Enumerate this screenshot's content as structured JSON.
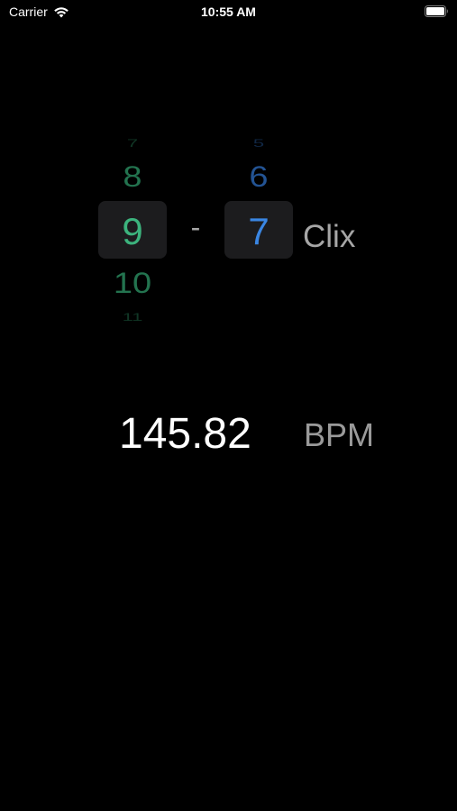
{
  "status_bar": {
    "carrier": "Carrier",
    "time": "10:55 AM",
    "wifi_icon": "wifi-icon",
    "battery_icon": "battery-icon"
  },
  "picker_left": {
    "items": [
      "7",
      "8",
      "9",
      "10",
      "11"
    ],
    "selected": "9",
    "color": "#3cb37d"
  },
  "picker_right": {
    "items": [
      "5",
      "6",
      "7"
    ],
    "selected": "7",
    "color": "#3a86e3"
  },
  "separator": "-",
  "clix_label": "Clix",
  "tempo": {
    "value": "145.82",
    "unit": "BPM"
  }
}
